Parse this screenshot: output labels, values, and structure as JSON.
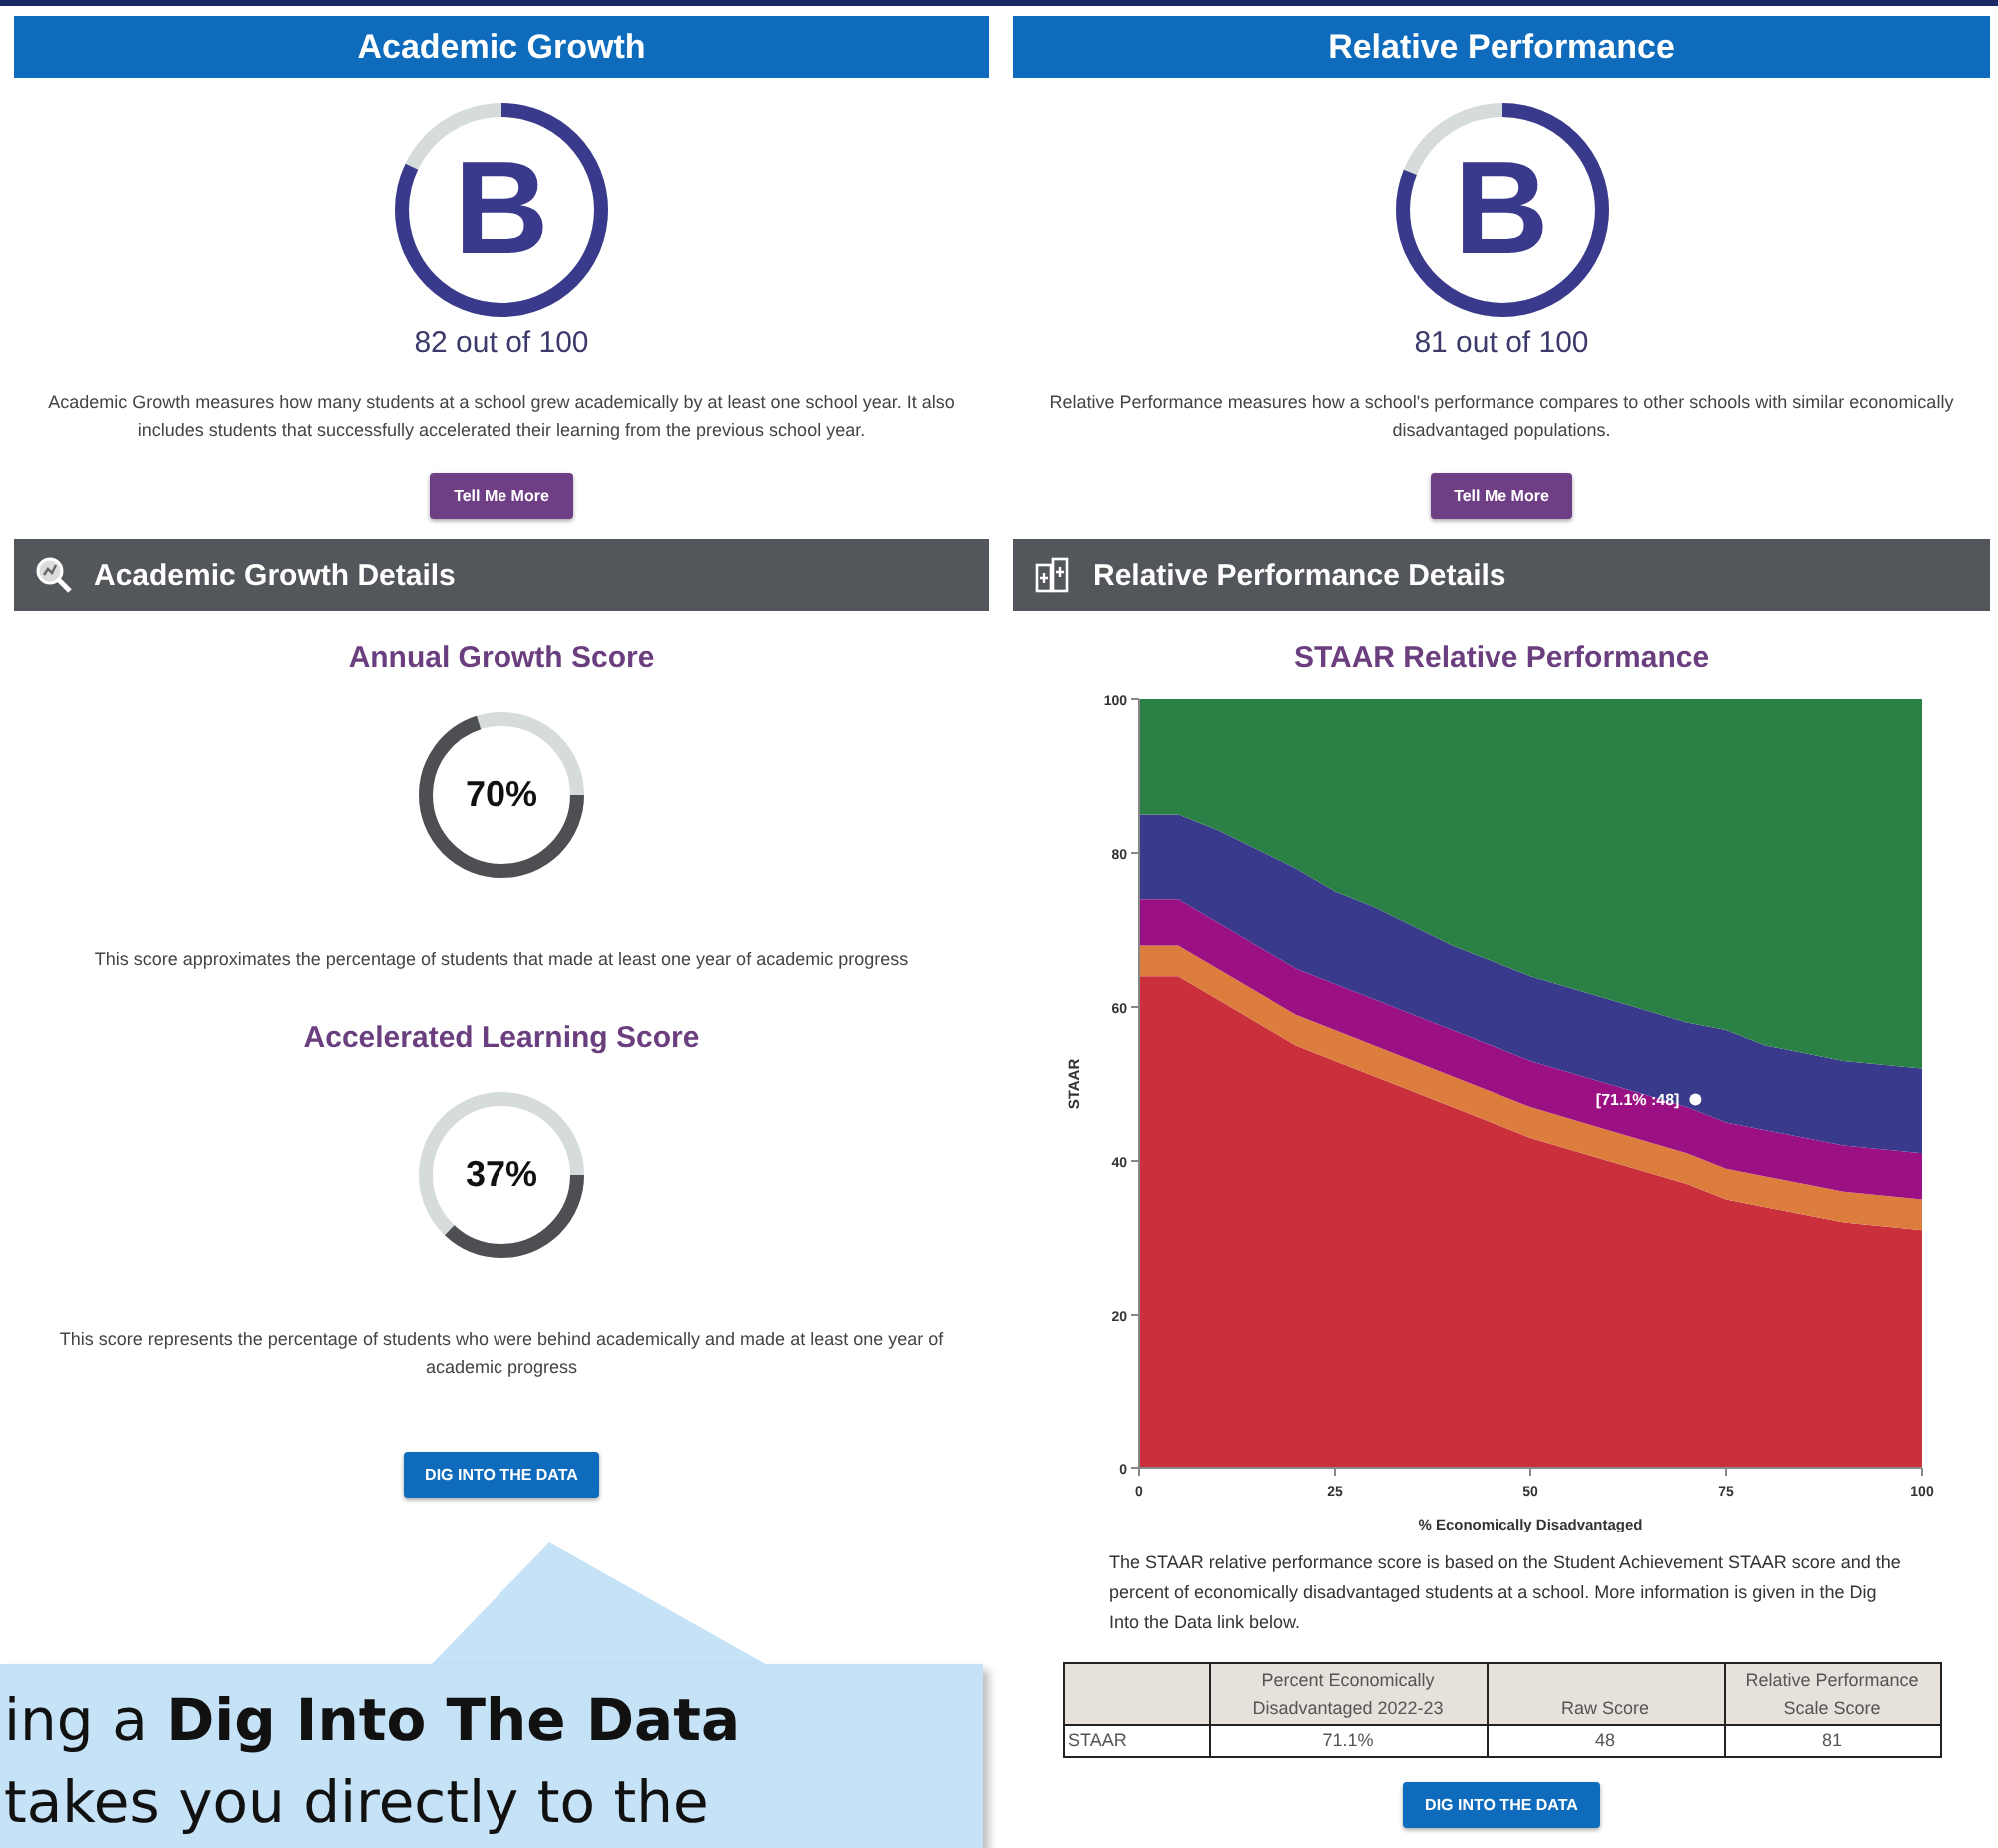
{
  "academic_growth": {
    "title": "Academic Growth",
    "grade": "B",
    "level": 0.82,
    "score_text": "82 out of 100",
    "description": "Academic Growth measures how many students at a school grew academically by at least one school year. It also includes students that successfully accelerated their learning from the previous school year.",
    "button": "Tell Me More",
    "details": {
      "title": "Academic Growth Details",
      "scores": [
        {
          "title": "Annual Growth Score",
          "value": "70%",
          "level": 0.7,
          "description": "This score approximates the percentage of students that made at least one year of academic progress"
        },
        {
          "title": "Accelerated Learning Score",
          "value": "37%",
          "level": 0.37,
          "description": "This score represents the percentage of students who were behind academically and made at least one year of academic progress"
        }
      ],
      "button": "DIG INTO THE DATA"
    }
  },
  "relative_performance": {
    "title": "Relative Performance",
    "grade": "B",
    "level": 0.81,
    "score_text": "81 out of 100",
    "description": "Relative Performance measures how a school's performance compares to other schools with similar economically disadvantaged populations.",
    "button": "Tell Me More",
    "details": {
      "title": "Relative Performance Details",
      "chart_data": {
        "type": "area",
        "title": "STAAR Relative Performance",
        "xlabel": "% Economically Disadvantaged",
        "ylabel": "STAAR",
        "stacked": true,
        "x": [
          0,
          5,
          10,
          20,
          25,
          30,
          40,
          50,
          60,
          70,
          75,
          80,
          90,
          100
        ],
        "xlim": [
          0,
          100
        ],
        "ylim": [
          0,
          100
        ],
        "xticks": [
          0,
          25,
          50,
          75,
          100
        ],
        "yticks": [
          0,
          20,
          40,
          60,
          80,
          100
        ],
        "series": [
          {
            "color": "#c9303c",
            "values": [
              64,
              64,
              61,
              55,
              53,
              51,
              47,
              43,
              40,
              37,
              35,
              34,
              32,
              31
            ]
          },
          {
            "color": "#dc7d3d",
            "values": [
              4,
              4,
              4,
              4,
              4,
              4,
              4,
              4,
              4,
              4,
              4,
              4,
              4,
              4
            ]
          },
          {
            "color": "#9b1184",
            "values": [
              6,
              6,
              6,
              6,
              6,
              6,
              6,
              6,
              6,
              6,
              6,
              6,
              6,
              6
            ]
          },
          {
            "color": "#3a3a8c",
            "values": [
              11,
              11,
              12,
              13,
              12,
              12,
              11,
              11,
              11,
              11,
              12,
              11,
              11,
              11
            ]
          },
          {
            "color": "#2a8045",
            "values": [
              15,
              15,
              17,
              22,
              25,
              27,
              32,
              36,
              39,
              42,
              43,
              45,
              47,
              48
            ]
          }
        ],
        "annotations": [
          {
            "x": 71.1,
            "y": 48,
            "text": "[71.1% :48]"
          }
        ]
      },
      "description": "The STAAR relative performance score is based on the Student Achievement STAAR score and the percent of economically disadvantaged students at a school. More information is given in the Dig Into the Data link below.",
      "table": {
        "columns": [
          "Percent Economically Disadvantaged 2022-23",
          "Raw Score",
          "Relative Performance Scale Score"
        ],
        "rows": [
          {
            "label": "STAAR",
            "cells": [
              "71.1%",
              "48",
              "81"
            ]
          }
        ]
      },
      "button": "DIG INTO THE DATA"
    }
  },
  "callout": {
    "lines": [
      "ing a **Dig Into The Data**",
      "takes you directly to the"
    ]
  }
}
